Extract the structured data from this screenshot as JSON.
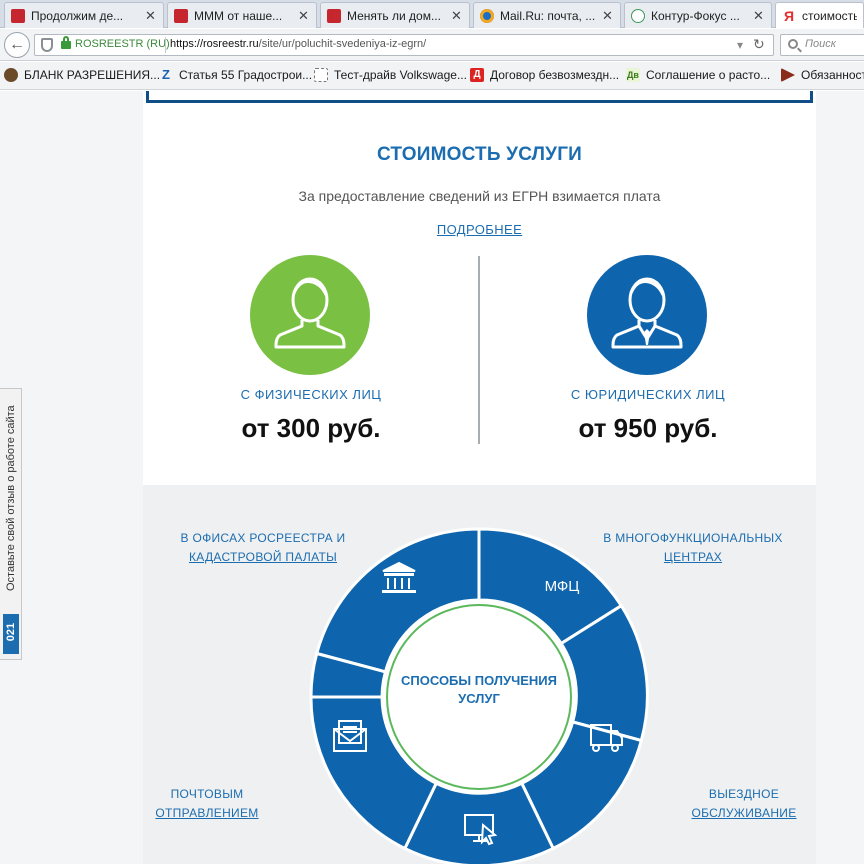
{
  "browser": {
    "tabs": [
      {
        "label": "Продолжим де...",
        "favicon": "red-flag-icon"
      },
      {
        "label": "МММ от наше...",
        "favicon": "red-flag-icon"
      },
      {
        "label": "Менять ли дом...",
        "favicon": "red-flag-icon"
      },
      {
        "label": "Mail.Ru: почта, ...",
        "favicon": "mail-ru-icon"
      },
      {
        "label": "Контур-Фокус ...",
        "favicon": "kontur-icon"
      },
      {
        "label": "стоимость",
        "favicon": "yandex-icon"
      }
    ],
    "site_identity": "ROSREESTR (RU)",
    "url_host": "https://rosreestr.ru",
    "url_path": "/site/ur/poluchit-svedeniya-iz-egrn/",
    "search_placeholder": "Поиск",
    "bookmarks": [
      {
        "label": "БЛАНК РАЗРЕШЕНИЯ...",
        "icon": "eagle-icon"
      },
      {
        "label": "Статья 55 Градострои...",
        "icon": "z-icon"
      },
      {
        "label": "Тест-драйв Volkswage...",
        "icon": "page-icon"
      },
      {
        "label": "Договор безвозмездн...",
        "icon": "d-icon"
      },
      {
        "label": "Соглашение о расто...",
        "icon": "dv-icon"
      },
      {
        "label": "Обязанности",
        "icon": "arrow-icon"
      }
    ]
  },
  "page": {
    "title": "СТОИМОСТЬ УСЛУГИ",
    "subtitle": "За предоставление сведений из ЕГРН взимается плата",
    "more_link": "ПОДРОБНЕЕ",
    "pricing": {
      "individuals_label": "С ФИЗИЧЕСКИХ ЛИЦ",
      "individuals_price": "от 300 руб.",
      "legal_label": "С ЮРИДИЧЕСКИХ ЛИЦ",
      "legal_price": "от 950 руб."
    },
    "ways": {
      "center_line1": "СПОСОБЫ ПОЛУЧЕНИЯ",
      "center_line2": "УСЛУГ",
      "mfc_segment_label": "МФЦ",
      "offices_line1": "В ОФИСАХ РОСРЕЕСТРА И",
      "offices_line2": "КАДАСТРОВОЙ ПАЛАТЫ",
      "mfc_line1": "В МНОГОФУНКЦИОНАЛЬНЫХ",
      "mfc_line2": "ЦЕНТРАХ",
      "post_line1": "ПОЧТОВЫМ",
      "post_line2": "ОТПРАВЛЕНИЕМ",
      "visit_line1": "ВЫЕЗДНОЕ",
      "visit_line2": "ОБСЛУЖИВАНИЕ"
    }
  },
  "feedback": {
    "text": "Оставьте свой отзыв о работе сайта",
    "badge": "021"
  },
  "colors": {
    "brand_blue": "#1c6db0",
    "ring_blue": "#0e65ad",
    "green": "#7ac143",
    "inner_ring_green": "#5cb85c"
  }
}
